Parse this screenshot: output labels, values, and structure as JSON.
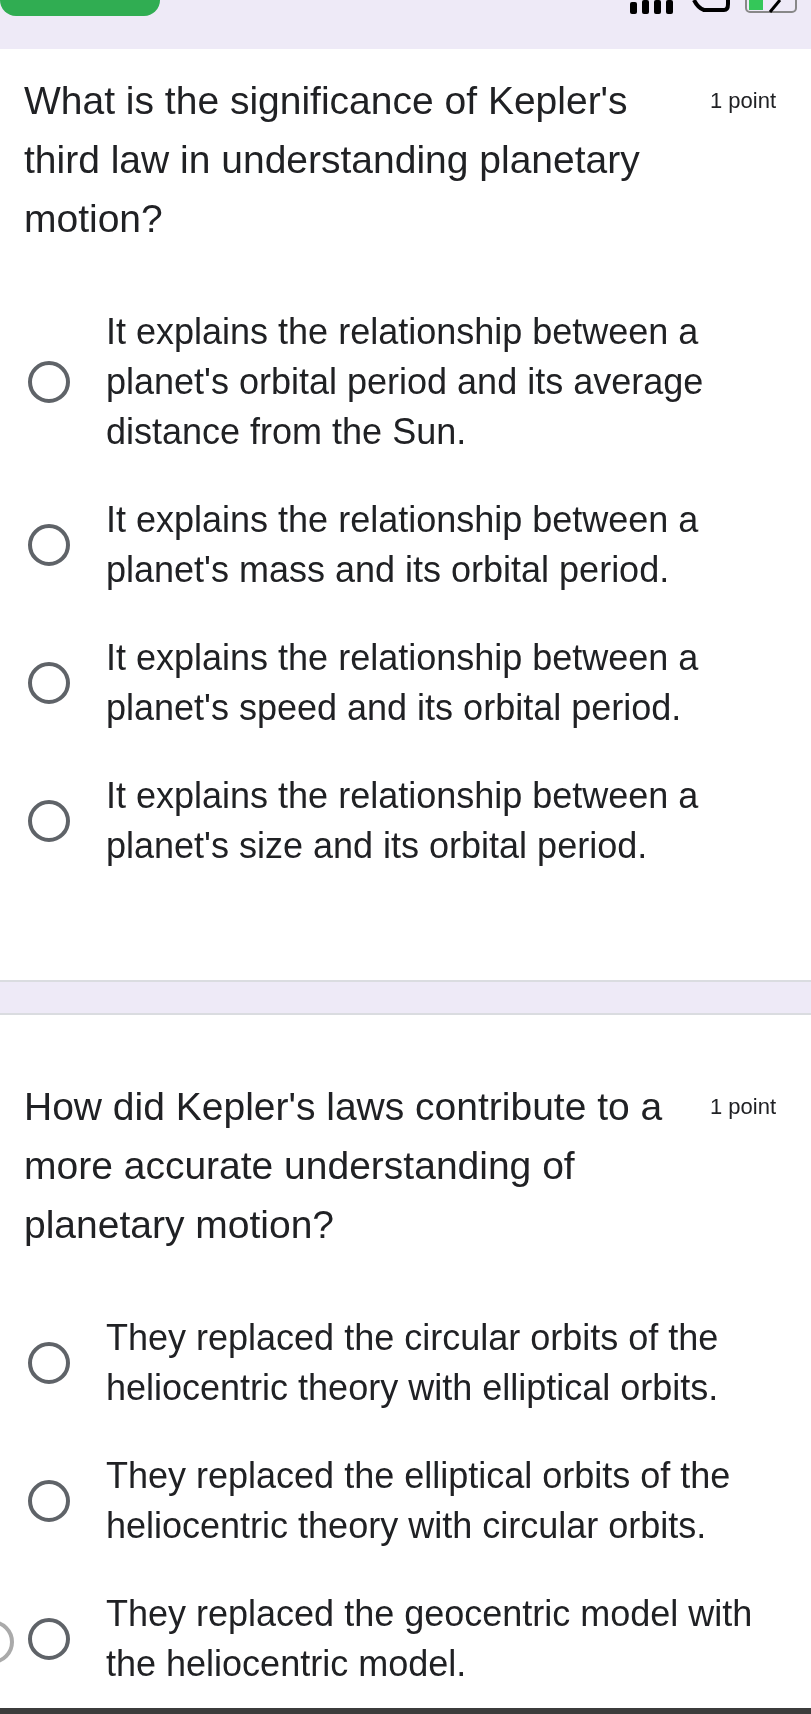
{
  "questions": [
    {
      "title": "What is the significance of Kepler's third law in understanding planetary motion?",
      "points": "1 point",
      "options": [
        {
          "label": "It explains the relationship between a planet's orbital period and its average distance from the Sun.",
          "selected": false
        },
        {
          "label": "It explains the relationship between a planet's mass and its orbital period.",
          "selected": false
        },
        {
          "label": "It explains the relationship between a planet's speed and its orbital period.",
          "selected": false
        },
        {
          "label": "It explains the relationship between a planet's size and its orbital period.",
          "selected": false
        }
      ]
    },
    {
      "title": "How did Kepler's laws contribute to a more accurate understanding of planetary motion?",
      "points": "1 point",
      "options": [
        {
          "label": "They replaced the circular orbits of the heliocentric theory with elliptical orbits.",
          "selected": false
        },
        {
          "label": "They replaced the elliptical orbits of the heliocentric theory with circular orbits.",
          "selected": false
        },
        {
          "label": "They replaced the geocentric model with the heliocentric model.",
          "selected": false
        }
      ]
    }
  ]
}
